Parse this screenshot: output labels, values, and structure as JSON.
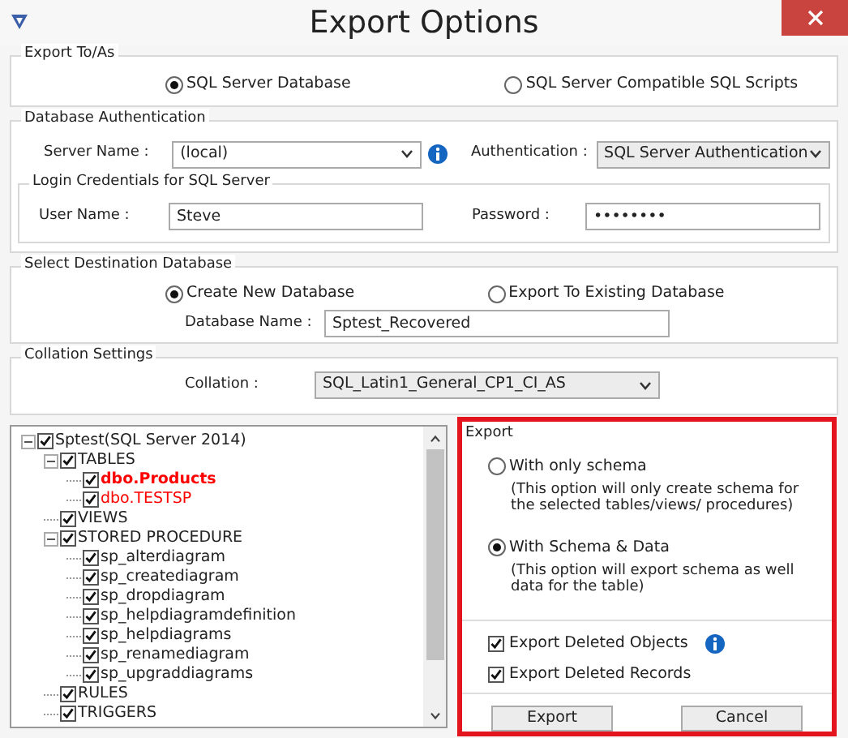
{
  "window": {
    "title": "Export Options"
  },
  "export_to": {
    "title": "Export To/As",
    "options": [
      {
        "label": "SQL Server Database",
        "selected": true
      },
      {
        "label": "SQL Server Compatible SQL Scripts",
        "selected": false
      }
    ]
  },
  "auth": {
    "title": "Database Authentication",
    "server_label": "Server Name :",
    "server_value": "(local)",
    "auth_label": "Authentication :",
    "auth_value": "SQL Server Authentication",
    "login": {
      "title": "Login Credentials for SQL Server",
      "user_label": "User Name :",
      "user_value": "Steve",
      "password_label": "Password :",
      "password_value": "••••••••"
    }
  },
  "destination": {
    "title": "Select Destination Database",
    "options": [
      {
        "label": "Create New Database",
        "selected": true
      },
      {
        "label": "Export To Existing Database",
        "selected": false
      }
    ],
    "name_label": "Database Name :",
    "name_value": "Sptest_Recovered"
  },
  "collation": {
    "title": "Collation Settings",
    "label": "Collation :",
    "value": "SQL_Latin1_General_CP1_CI_AS"
  },
  "tree": [
    {
      "label": "Sptest(SQL Server 2014)",
      "checked": true,
      "expanded": true,
      "selected": false,
      "children": [
        {
          "label": "TABLES",
          "checked": true,
          "expanded": true,
          "selected": false,
          "children": [
            {
              "label": "dbo.Products",
              "checked": true,
              "selected": true,
              "color": "#ff0000"
            },
            {
              "label": "dbo.TESTSP",
              "checked": true,
              "selected": false,
              "color": "#ff0000"
            }
          ]
        },
        {
          "label": "VIEWS",
          "checked": true,
          "selected": false
        },
        {
          "label": "STORED PROCEDURE",
          "checked": true,
          "expanded": true,
          "selected": false,
          "children": [
            {
              "label": "sp_alterdiagram",
              "checked": true,
              "selected": false
            },
            {
              "label": "sp_creatediagram",
              "checked": true,
              "selected": false
            },
            {
              "label": "sp_dropdiagram",
              "checked": true,
              "selected": false
            },
            {
              "label": "sp_helpdiagramdefinition",
              "checked": true,
              "selected": false
            },
            {
              "label": "sp_helpdiagrams",
              "checked": true,
              "selected": false
            },
            {
              "label": "sp_renamediagram",
              "checked": true,
              "selected": false
            },
            {
              "label": "sp_upgraddiagrams",
              "checked": true,
              "selected": false
            }
          ]
        },
        {
          "label": "RULES",
          "checked": true,
          "selected": false
        },
        {
          "label": "TRIGGERS",
          "checked": true,
          "selected": false
        }
      ]
    }
  ],
  "export": {
    "title": "Export",
    "options": [
      {
        "label": "With only schema",
        "selected": false,
        "note": "(This option will only create schema for the  selected tables/views/ procedures)"
      },
      {
        "label": "With Schema & Data",
        "selected": true,
        "note": "(This option will export schema as well data for the table)"
      }
    ],
    "checks": [
      {
        "label": "Export Deleted Objects",
        "checked": true,
        "info": true
      },
      {
        "label": "Export Deleted Records",
        "checked": true,
        "info": false
      }
    ],
    "buttons": [
      "Export",
      "Cancel"
    ]
  }
}
